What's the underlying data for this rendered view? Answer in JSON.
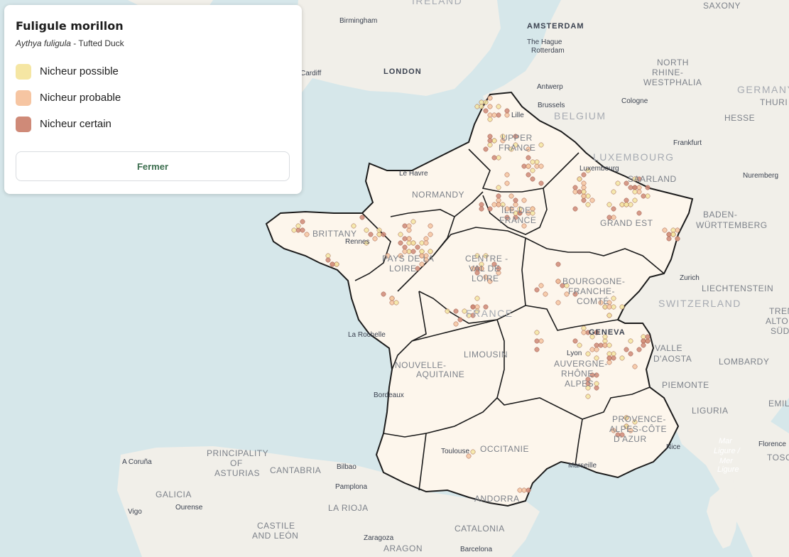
{
  "legend": {
    "title": "Fuligule morillon",
    "scientific_name": "Aythya fuligula",
    "sub_sep": " - ",
    "common_name": "Tufted Duck",
    "items": [
      {
        "label": "Nicheur possible",
        "color": "#f5e6a3"
      },
      {
        "label": "Nicheur probable",
        "color": "#f6c5a2"
      },
      {
        "label": "Nicheur certain",
        "color": "#cf8a78"
      }
    ],
    "close_label": "Fermer"
  },
  "map_labels": {
    "regions": [
      "UPPER",
      "FRANCE",
      "NORMANDY",
      "BRITTANY",
      "PAYS DE LA",
      "LOIRE",
      "ÎLE-DE-",
      "FRANCE",
      "GRAND EST",
      "CENTRE -",
      "VAL DE",
      "LOIRE",
      "BOURGOGNE-",
      "FRANCHE-",
      "COMTÉ",
      "NOUVELLE-",
      "AQUITAINE",
      "LIMOUSIN",
      "AUVERGNE-",
      "RHÔNE-",
      "ALPES",
      "OCCITANIE",
      "PROVENCE-",
      "ALPES-CÔTE",
      "D'AZUR",
      "NORTH",
      "RHINE-",
      "WESTPHALIA",
      "BADEN-",
      "WÜRTTEMBERG",
      "PRINCIPALITY",
      "OF",
      "ASTURIAS",
      "CANTABRIA",
      "GALICIA",
      "CASTILE",
      "AND LEÓN",
      "LA RIOJA",
      "ARAGON",
      "CATALONIA",
      "ANDORRA",
      "VALLE",
      "D'AOSTA",
      "PIEMONTE",
      "LOMBARDY",
      "LIGURIA",
      "EMIL",
      "TOSC",
      "TRENT",
      "ALTO",
      "SÜD",
      "HESSE",
      "SAARLAND",
      "SAXONY",
      "THURI"
    ],
    "countries": [
      "BELGIUM",
      "LUXEMBOURG",
      "FRANCE",
      "SWITZERLAND",
      "LIECHTENSTEIN",
      "GERMANY",
      "IRELAND"
    ],
    "cities": [
      "Birmingham",
      "AMSTERDAM",
      "The Hague",
      "Rotterdam",
      "Cardiff",
      "LONDON",
      "Antwerp",
      "Brussels",
      "Cologne",
      "Lille",
      "Frankfurt",
      "Luxembourg",
      "Nuremberg",
      "Le Havre",
      "Rennes",
      "Zurich",
      "GENEVA",
      "La Rochelle",
      "Lyon",
      "Bordeaux",
      "Toulouse",
      "Marseille",
      "Nice",
      "Florence",
      "A Coruña",
      "Bilbao",
      "Pamplona",
      "Ourense",
      "Vigo",
      "Zaragoza",
      "Barcelona"
    ],
    "sea": [
      "Mar",
      "Ligure /",
      "Mer",
      "Ligure"
    ]
  }
}
